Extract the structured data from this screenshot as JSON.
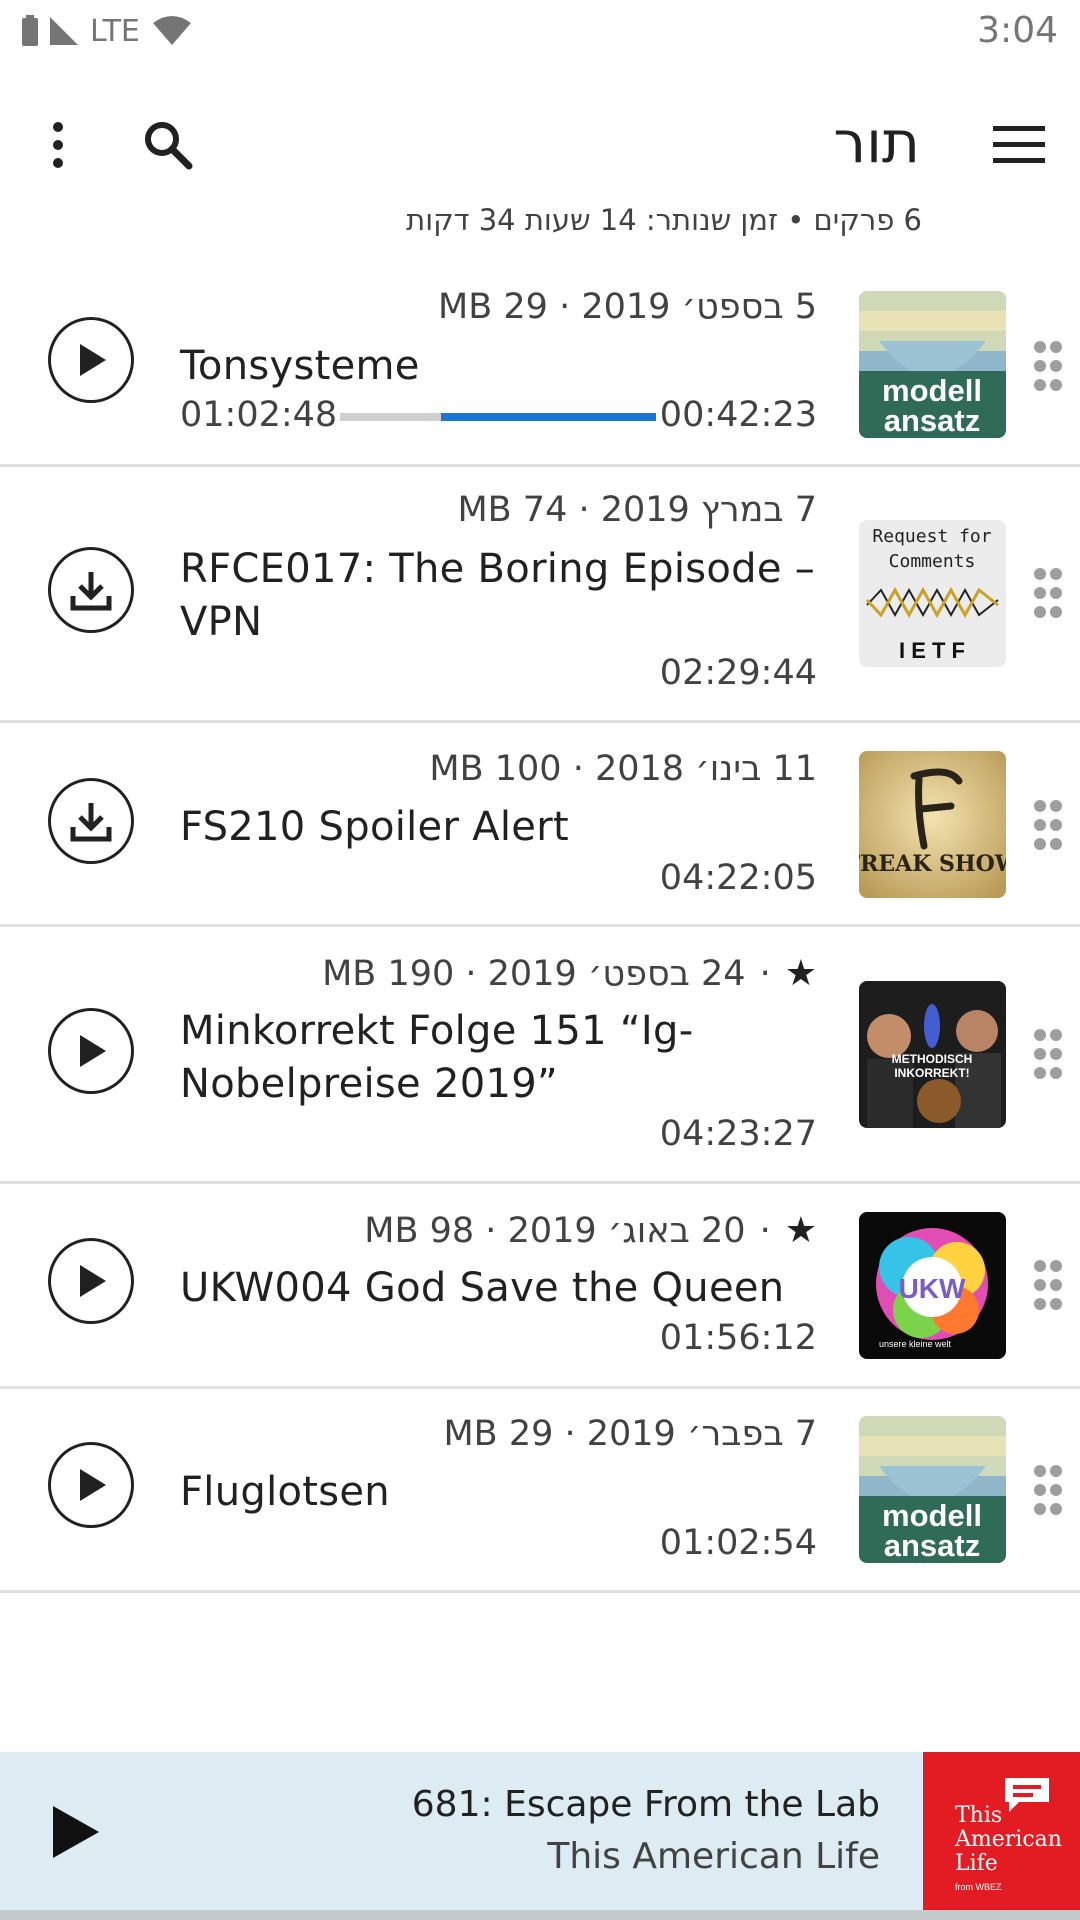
{
  "status_bar": {
    "network": "LTE",
    "time": "3:04"
  },
  "toolbar": {
    "title": "תור",
    "summary": "6 פרקים • זמן שנותר: 14 שעות 34 דקות"
  },
  "episodes": [
    {
      "meta": "5 בספט׳ 2019 · 29 MB",
      "title": "Tonsysteme",
      "position": "00:42:23",
      "duration": "01:02:48",
      "progress_fraction": 0.68,
      "action": "play",
      "favorite": false,
      "cover": "modell-ansatz",
      "cover_text": [
        "modell",
        "ansatz"
      ]
    },
    {
      "meta": "7 במרץ 2019 · 74 MB",
      "title": "RFCE017: The Boring Episode – VPN",
      "duration": "02:29:44",
      "action": "download",
      "favorite": false,
      "cover": "request-for-comments",
      "cover_text": [
        "Request for",
        "Comments",
        "I E T F"
      ]
    },
    {
      "meta": "11 בינו׳ 2018 · 100 MB",
      "title": "FS210 Spoiler Alert",
      "duration": "04:22:05",
      "action": "download",
      "favorite": false,
      "cover": "freak-show",
      "cover_text": [
        "FREAK SHOW"
      ]
    },
    {
      "meta": "24 בספט׳ 2019 · 190 MB",
      "title": "Minkorrekt Folge 151 “Ig-Nobelpreise 2019”",
      "duration": "04:23:27",
      "action": "play",
      "favorite": true,
      "cover": "methodisch-inkorrekt",
      "cover_text": [
        "METHODISCH",
        "INKORREKT!"
      ]
    },
    {
      "meta": "20 באוג׳ 2019 · 98 MB",
      "title": "UKW004 God Save the Queen",
      "duration": "01:56:12",
      "action": "play",
      "favorite": true,
      "cover": "ukw",
      "cover_text": [
        "UKW",
        "unsere kleine welt"
      ]
    },
    {
      "meta": "7 בפבר׳ 2019 · 29 MB",
      "title": "Fluglotsen",
      "duration": "01:02:54",
      "action": "play",
      "favorite": false,
      "cover": "modell-ansatz",
      "cover_text": [
        "modell",
        "ansatz"
      ]
    }
  ],
  "separator": "·",
  "player": {
    "title": "681: Escape From the Lab",
    "podcast": "This American Life",
    "cover_text": [
      "This",
      "American",
      "Life"
    ],
    "cover_small": "from WBEZ"
  },
  "colors": {
    "accent": "#1976d2",
    "player_bg": "#ddebf2",
    "tal_red": "#e31b23"
  }
}
